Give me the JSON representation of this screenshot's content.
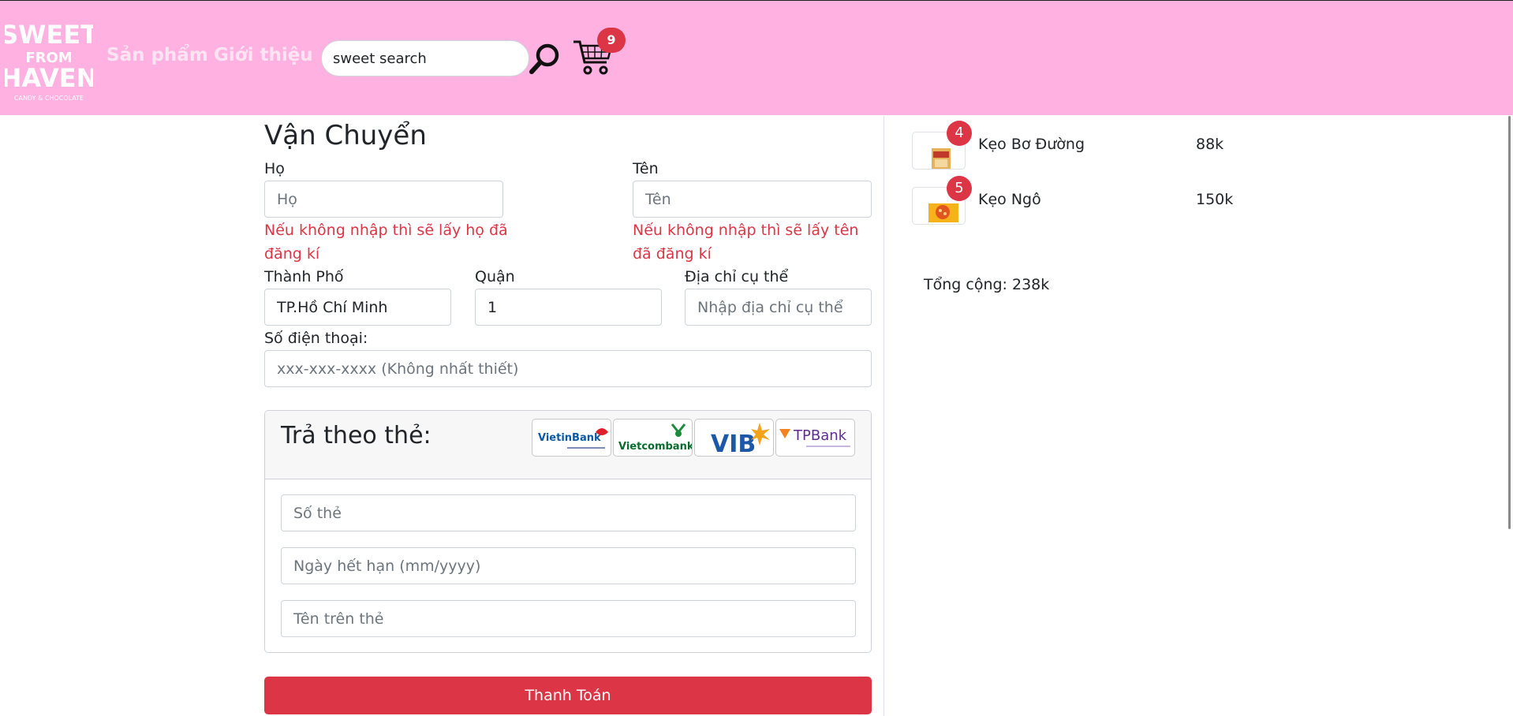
{
  "header": {
    "logo_lines": [
      "SWEET",
      "FROM",
      "HAVEN"
    ],
    "logo_tagline": "CANDY & CHOCOLATE",
    "nav": [
      "Sản phẩm",
      "Giới thiệu"
    ],
    "search_value": "sweet search",
    "cart_count": "9",
    "bg_color": "#ffb1e1"
  },
  "shipping": {
    "title": "Vận Chuyển",
    "last_name_label": "Họ",
    "last_name_placeholder": "Họ",
    "last_name_hint": "Nếu không nhập thì sẽ lấy họ đã đăng kí",
    "first_name_label": "Tên",
    "first_name_placeholder": "Tên",
    "first_name_hint": "Nếu không nhập thì sẽ lấy tên đã đăng kí",
    "city_label": "Thành Phố",
    "city_value": "TP.Hồ Chí Minh",
    "district_label": "Quận",
    "district_value": "1",
    "address_label": "Địa chỉ cụ thể",
    "address_placeholder": "Nhập địa chỉ cụ thể",
    "phone_label": "Số điện thoại:",
    "phone_placeholder": "xxx-xxx-xxxx (Không nhất thiết)"
  },
  "payment": {
    "title": "Trả theo thẻ:",
    "banks": [
      "VietinBank",
      "Vietcombank",
      "VIB",
      "TPBank"
    ],
    "card_number_placeholder": "Số thẻ",
    "expiry_placeholder": "Ngày hết hạn (mm/yyyy)",
    "card_name_placeholder": "Tên trên thẻ",
    "submit_label": "Thanh Toán",
    "accent_color": "#dc3545"
  },
  "cart": {
    "items": [
      {
        "name": "Kẹo Bơ Đường",
        "price": "88k",
        "qty": "4"
      },
      {
        "name": "Kẹo Ngô",
        "price": "150k",
        "qty": "5"
      }
    ],
    "total": "Tổng cộng: 238k"
  }
}
